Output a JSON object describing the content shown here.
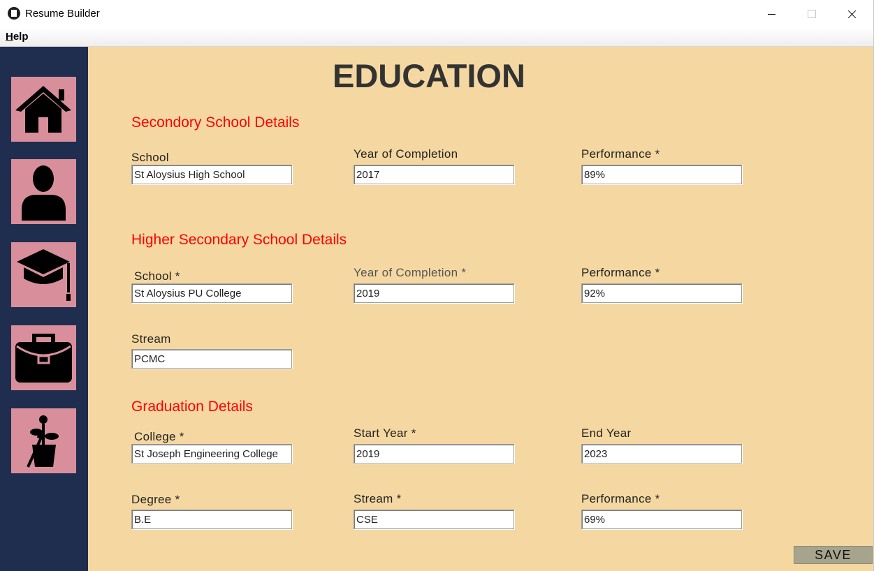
{
  "window": {
    "title": "Resume Builder"
  },
  "menu": {
    "help_first": "H",
    "help_rest": "elp"
  },
  "sidebar": {
    "items": [
      {
        "icon": "home-icon"
      },
      {
        "icon": "user-icon"
      },
      {
        "icon": "graduation-cap-icon"
      },
      {
        "icon": "briefcase-icon"
      },
      {
        "icon": "plant-icon"
      }
    ]
  },
  "page": {
    "title": "EDUCATION"
  },
  "secondary": {
    "heading": "Secondory School Details",
    "school_label": "School",
    "school_value": "St Aloysius High School",
    "year_label": "Year of Completion",
    "year_value": "2017",
    "perf_label": "Performance *",
    "perf_value": "89%"
  },
  "higher_secondary": {
    "heading": "Higher Secondary School Details",
    "school_label": "School *",
    "school_value": "St Aloysius PU College",
    "year_label": "Year of Completion *",
    "year_value": "2019",
    "perf_label": "Performance *",
    "perf_value": "92%",
    "stream_label": "Stream",
    "stream_value": "PCMC"
  },
  "graduation": {
    "heading": "Graduation Details",
    "college_label": "College *",
    "college_value": "St Joseph Engineering College",
    "start_label": "Start Year *",
    "start_value": "2019",
    "end_label": "End Year",
    "end_value": "2023",
    "degree_label": "Degree *",
    "degree_value": "B.E",
    "stream_label": "Stream *",
    "stream_value": "CSE",
    "perf_label": "Performance *",
    "perf_value": "69%"
  },
  "actions": {
    "save_label": "SAVE"
  },
  "colors": {
    "sidebar": "#1f2d4f",
    "nav_button": "#d88f9b",
    "content_bg": "#f5d8a1",
    "section_heading": "#ff0000",
    "save_button": "#a7a48d"
  }
}
